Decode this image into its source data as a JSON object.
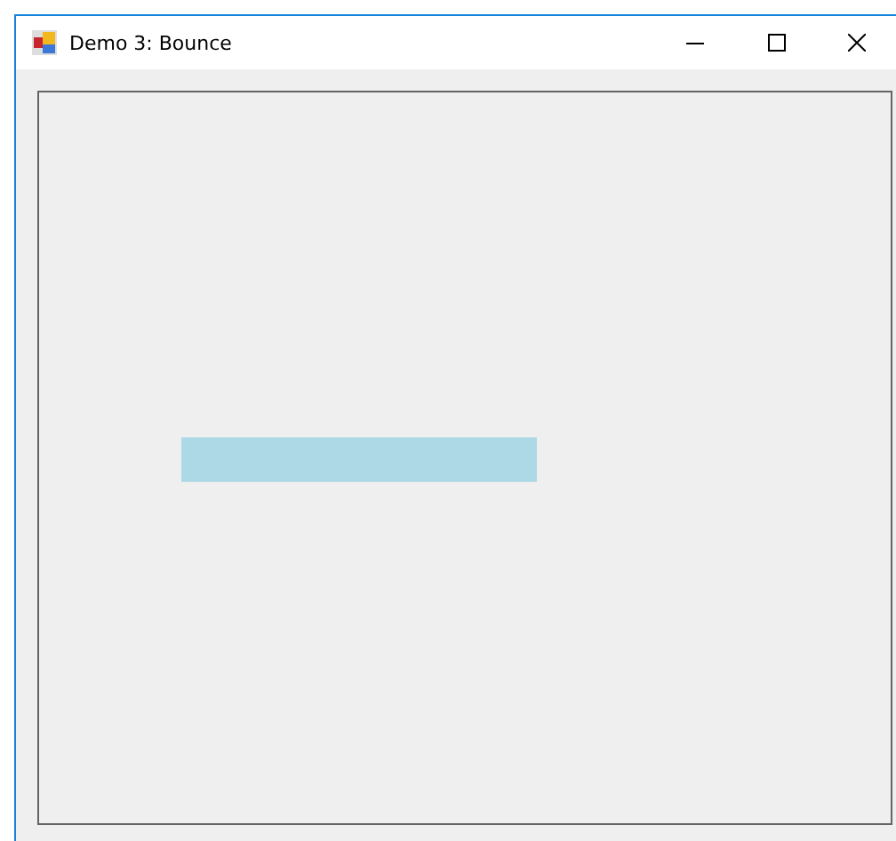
{
  "window": {
    "title": "Demo 3: Bounce"
  }
}
